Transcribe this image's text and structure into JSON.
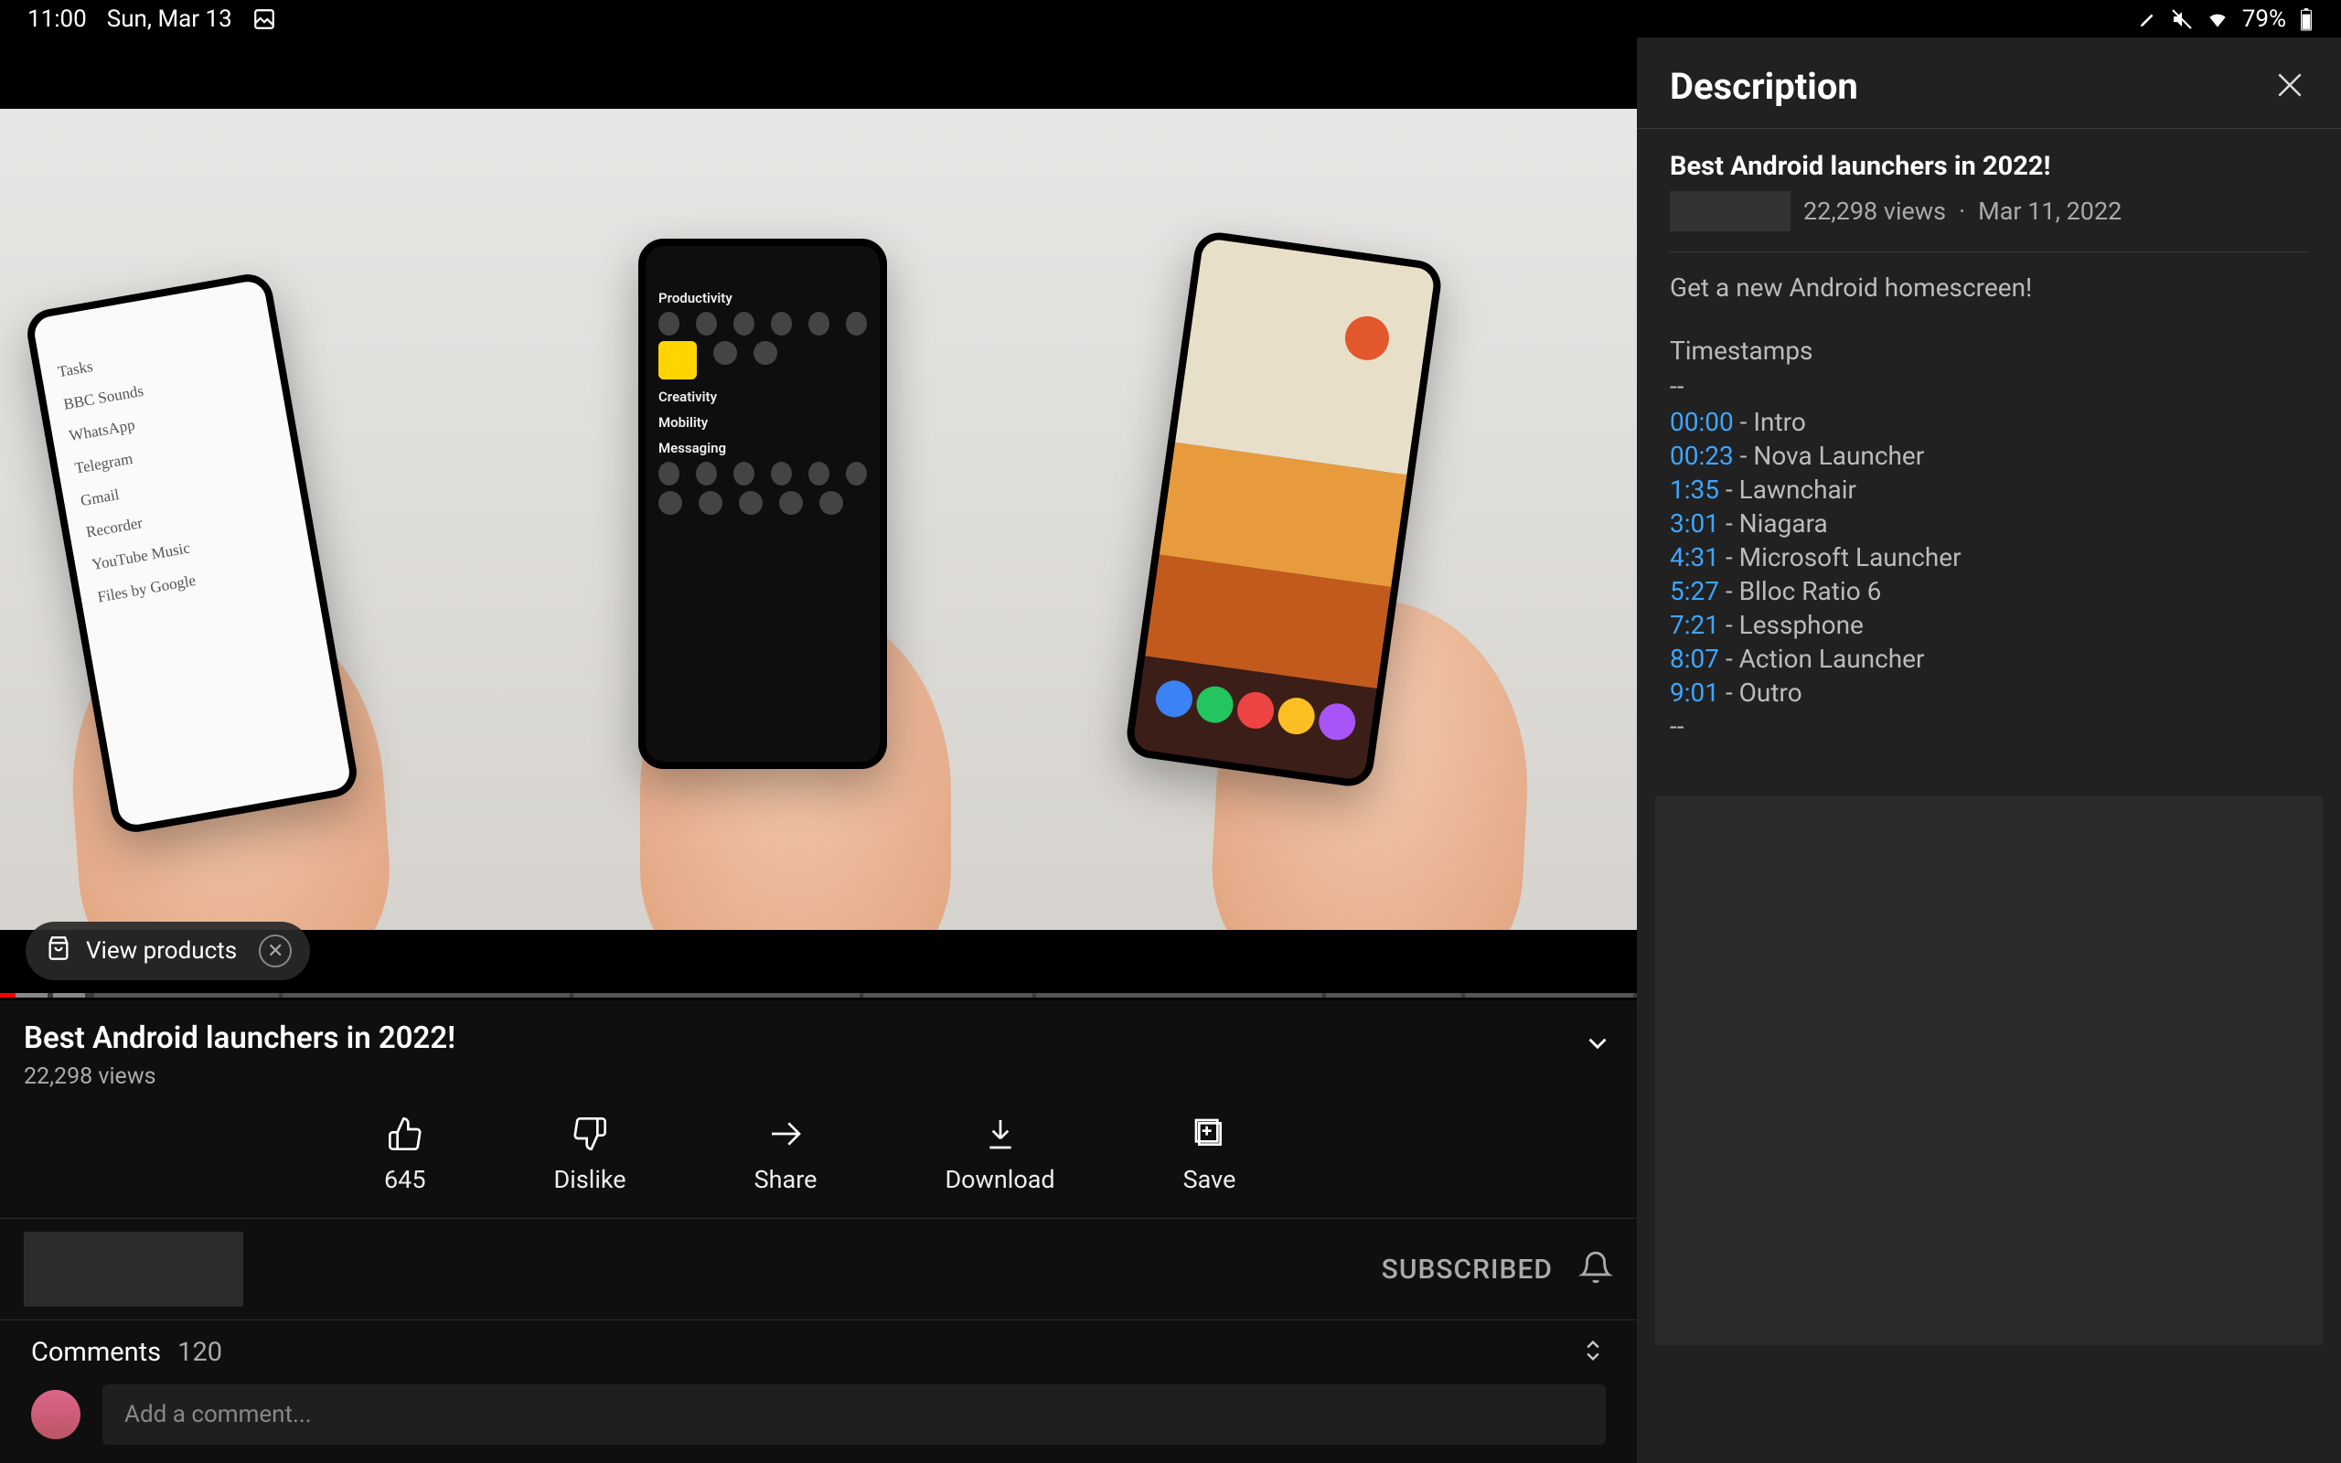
{
  "status": {
    "time": "11:00",
    "date": "Sun, Mar 13",
    "battery": "79%"
  },
  "video": {
    "title": "Best Android launchers in 2022!",
    "views": "22,298 views",
    "view_products_label": "View products",
    "phone1_apps": [
      "Tasks",
      "BBC Sounds",
      "WhatsApp",
      "Telegram",
      "Gmail",
      "Recorder",
      "YouTube Music",
      "Files by Google"
    ],
    "phone2_sections": [
      "Productivity",
      "Creativity",
      "Mobility",
      "Messaging"
    ]
  },
  "actions": {
    "likes": "645",
    "dislike": "Dislike",
    "share": "Share",
    "download": "Download",
    "save": "Save"
  },
  "channel": {
    "subscribed_label": "SUBSCRIBED"
  },
  "comments": {
    "label": "Comments",
    "count": "120",
    "placeholder": "Add a comment..."
  },
  "description": {
    "panel_title": "Description",
    "video_title": "Best Android launchers in 2022!",
    "views": "22,298 views",
    "date": "Mar 11, 2022",
    "tagline": "Get a new Android homescreen!",
    "timestamps_heading": "Timestamps",
    "dashes": "--",
    "timestamps": [
      {
        "time": "00:00",
        "label": "Intro"
      },
      {
        "time": "00:23",
        "label": "Nova Launcher"
      },
      {
        "time": "1:35",
        "label": "Lawnchair"
      },
      {
        "time": "3:01",
        "label": "Niagara"
      },
      {
        "time": "4:31",
        "label": "Microsoft Launcher"
      },
      {
        "time": "5:27",
        "label": "Blloc Ratio 6"
      },
      {
        "time": "7:21",
        "label": "Lessphone"
      },
      {
        "time": "8:07",
        "label": "Action Launcher"
      },
      {
        "time": "9:01",
        "label": "Outro"
      }
    ]
  }
}
